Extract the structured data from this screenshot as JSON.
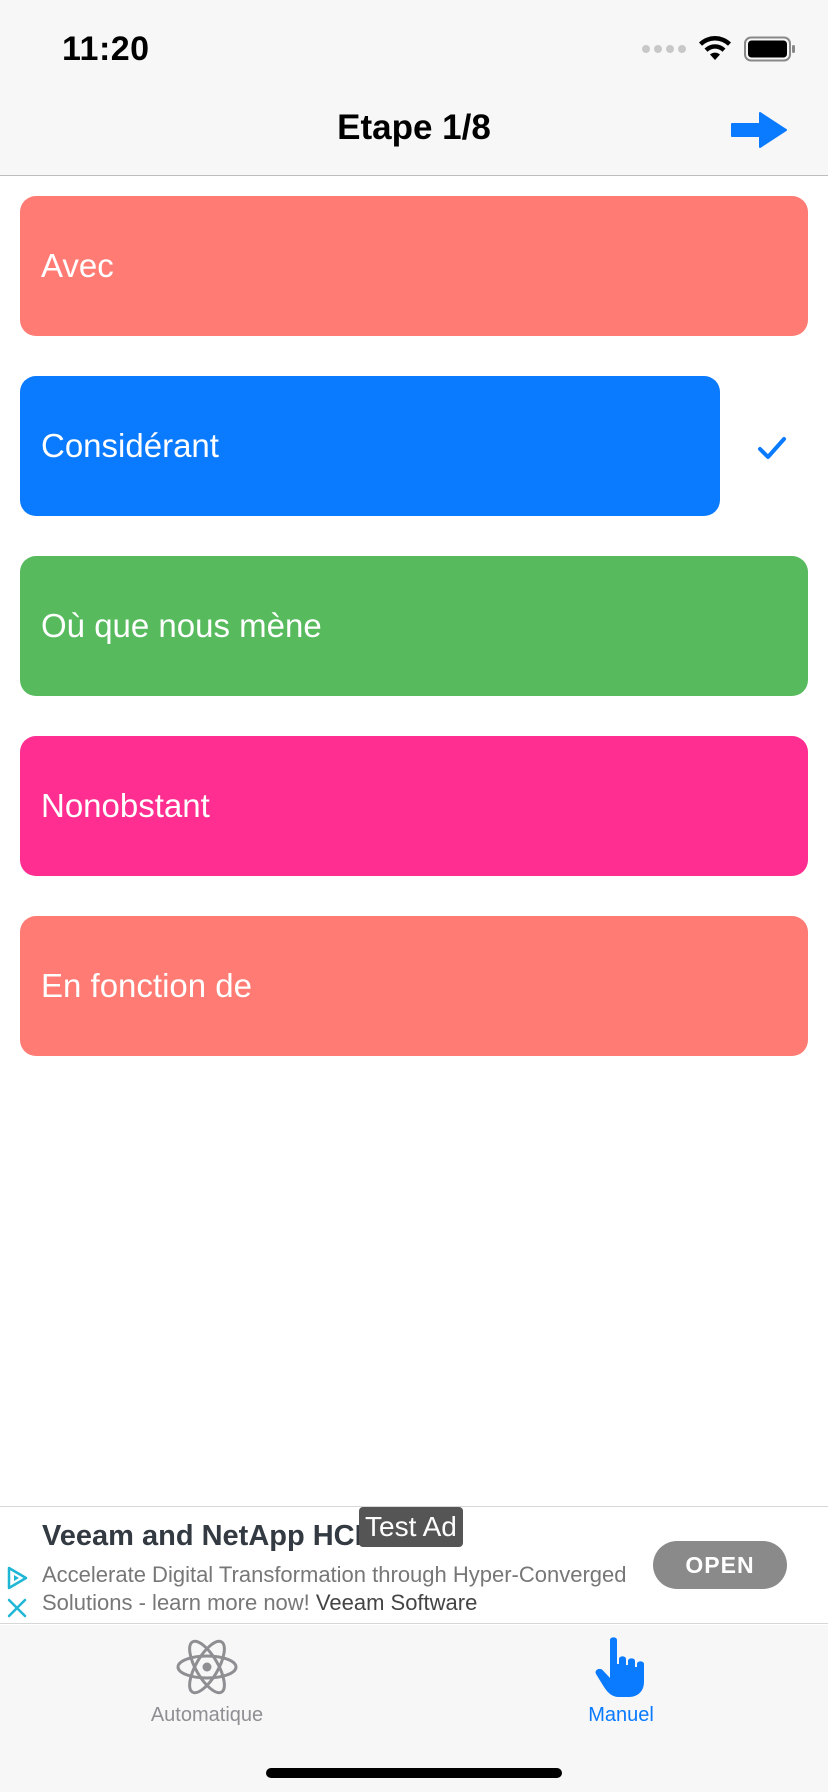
{
  "status_bar": {
    "time": "11:20"
  },
  "nav": {
    "title": "Etape 1/8"
  },
  "options": [
    {
      "label": "Avec",
      "color": "#ff7b73",
      "selected": false
    },
    {
      "label": "Considérant",
      "color": "#0a7aff",
      "selected": true
    },
    {
      "label": "Où que nous mène",
      "color": "#57bb5e",
      "selected": false
    },
    {
      "label": "Nonobstant",
      "color": "#ff2e90",
      "selected": false
    },
    {
      "label": "En fonction de",
      "color": "#ff7b73",
      "selected": false
    }
  ],
  "ad": {
    "title": "Veeam and NetApp HCI",
    "badge": "Test Ad",
    "description": "Accelerate Digital Transformation through Hyper-Converged Solutions - learn more now!",
    "advertiser": "Veeam Software",
    "cta": "OPEN"
  },
  "tabs": [
    {
      "label": "Automatique",
      "icon": "atom-icon",
      "active": false
    },
    {
      "label": "Manuel",
      "icon": "hand-pointer-icon",
      "active": true
    }
  ],
  "colors": {
    "accent": "#0a7aff",
    "inactive": "#8e8e93"
  }
}
